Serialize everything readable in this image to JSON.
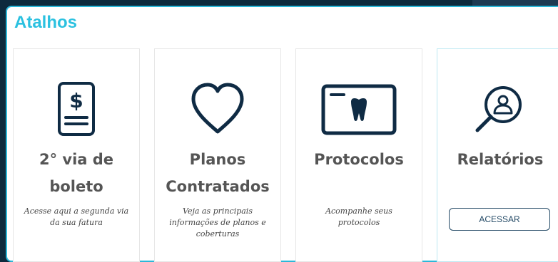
{
  "section": {
    "title": "Atalhos"
  },
  "cards": [
    {
      "title_line1": "2° via de",
      "title_line2": "boleto",
      "description": "Acesse aqui a segunda via da sua fatura",
      "icon": "invoice-dollar-icon"
    },
    {
      "title_line1": "Planos",
      "title_line2": "Contratados",
      "description": "Veja as principais informações de planos e coberturas",
      "icon": "heart-icon"
    },
    {
      "title_line1": "Protocolos",
      "description": "Acompanhe seus protocolos",
      "icon": "dental-card-icon"
    },
    {
      "title_line1": "Relatórios",
      "button_label": "ACESSAR",
      "icon": "search-person-icon"
    }
  ],
  "colors": {
    "accent": "#2bc1e0",
    "icon": "#0f2b44",
    "text": "#555555"
  }
}
